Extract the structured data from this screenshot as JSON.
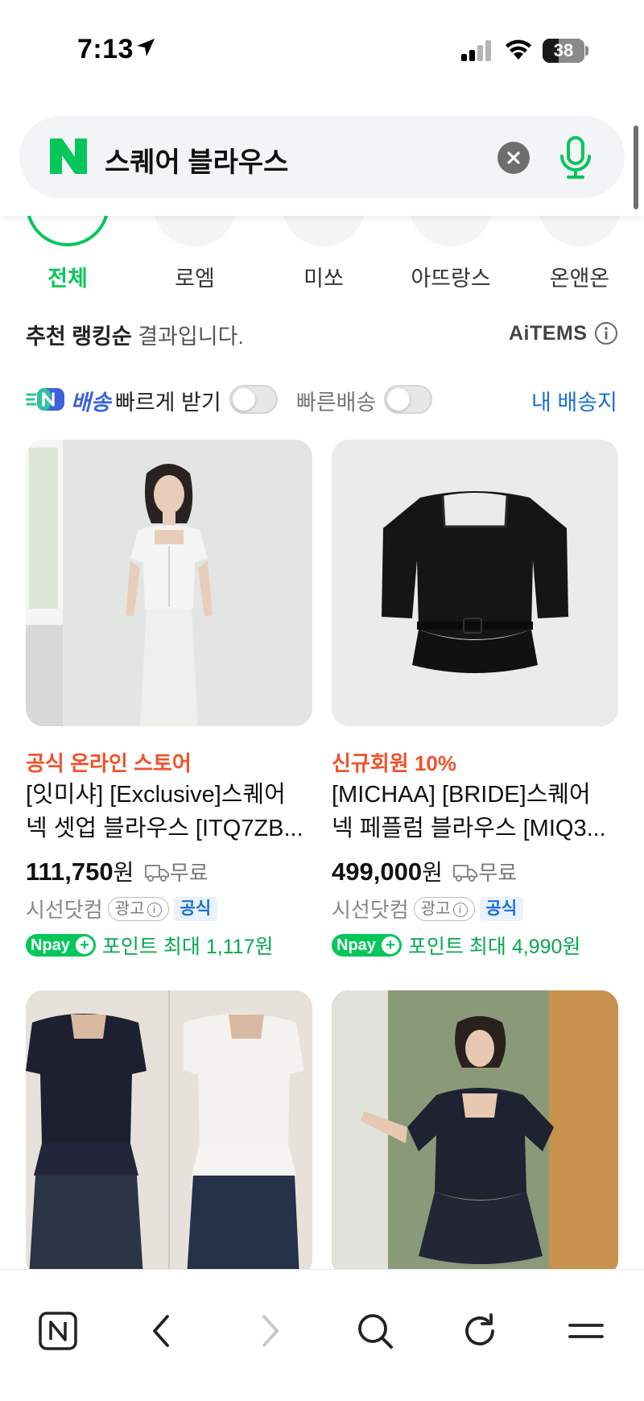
{
  "status_bar": {
    "time": "7:13",
    "battery": "38",
    "battery_fraction": 0.38
  },
  "search": {
    "query": "스퀘어 블라우스"
  },
  "brand_tabs": [
    {
      "label": "전체",
      "active": true
    },
    {
      "label": "로엠",
      "active": false
    },
    {
      "label": "미쏘",
      "active": false
    },
    {
      "label": "아뜨랑스",
      "active": false
    },
    {
      "label": "온앤온",
      "active": false
    }
  ],
  "sort": {
    "bold": "추천 랭킹순",
    "suffix": " 결과입니다.",
    "provider": "AiTEMS"
  },
  "delivery": {
    "brand": "배송",
    "label": "빠르게 받기",
    "fast_label": "빠른배송",
    "address_link": "내 배송지"
  },
  "products": [
    {
      "promo": "공식 온라인 스토어",
      "title": "[잇미샤] [Exclusive]스퀘어 넥 셋업 블라우스 [ITQ7ZB...",
      "price": "111,750",
      "currency": "원",
      "shipping": "무료",
      "seller": "시선닷컴",
      "ad_label": "광고",
      "official": "공식",
      "npay": "pay",
      "points": "포인트 최대 1,117원"
    },
    {
      "promo": "신규회원 10%",
      "title": "[MICHAA] [BRIDE]스퀘어 넥 페플럼 블라우스 [MIQ3...",
      "price": "499,000",
      "currency": "원",
      "shipping": "무료",
      "seller": "시선닷컴",
      "ad_label": "광고",
      "official": "공식",
      "npay": "pay",
      "points": "포인트 최대 4,990원"
    },
    {
      "image": "two models in navy and white peplum blouses"
    },
    {
      "image": "model in navy peplum blouse"
    }
  ],
  "colors": {
    "naver_green": "#03c75a",
    "promo_orange": "#f0522b",
    "link_blue": "#1b6fd8",
    "point_green": "#03a94e"
  },
  "bottom_nav": [
    "naver-home",
    "back",
    "forward",
    "search",
    "refresh",
    "menu"
  ]
}
